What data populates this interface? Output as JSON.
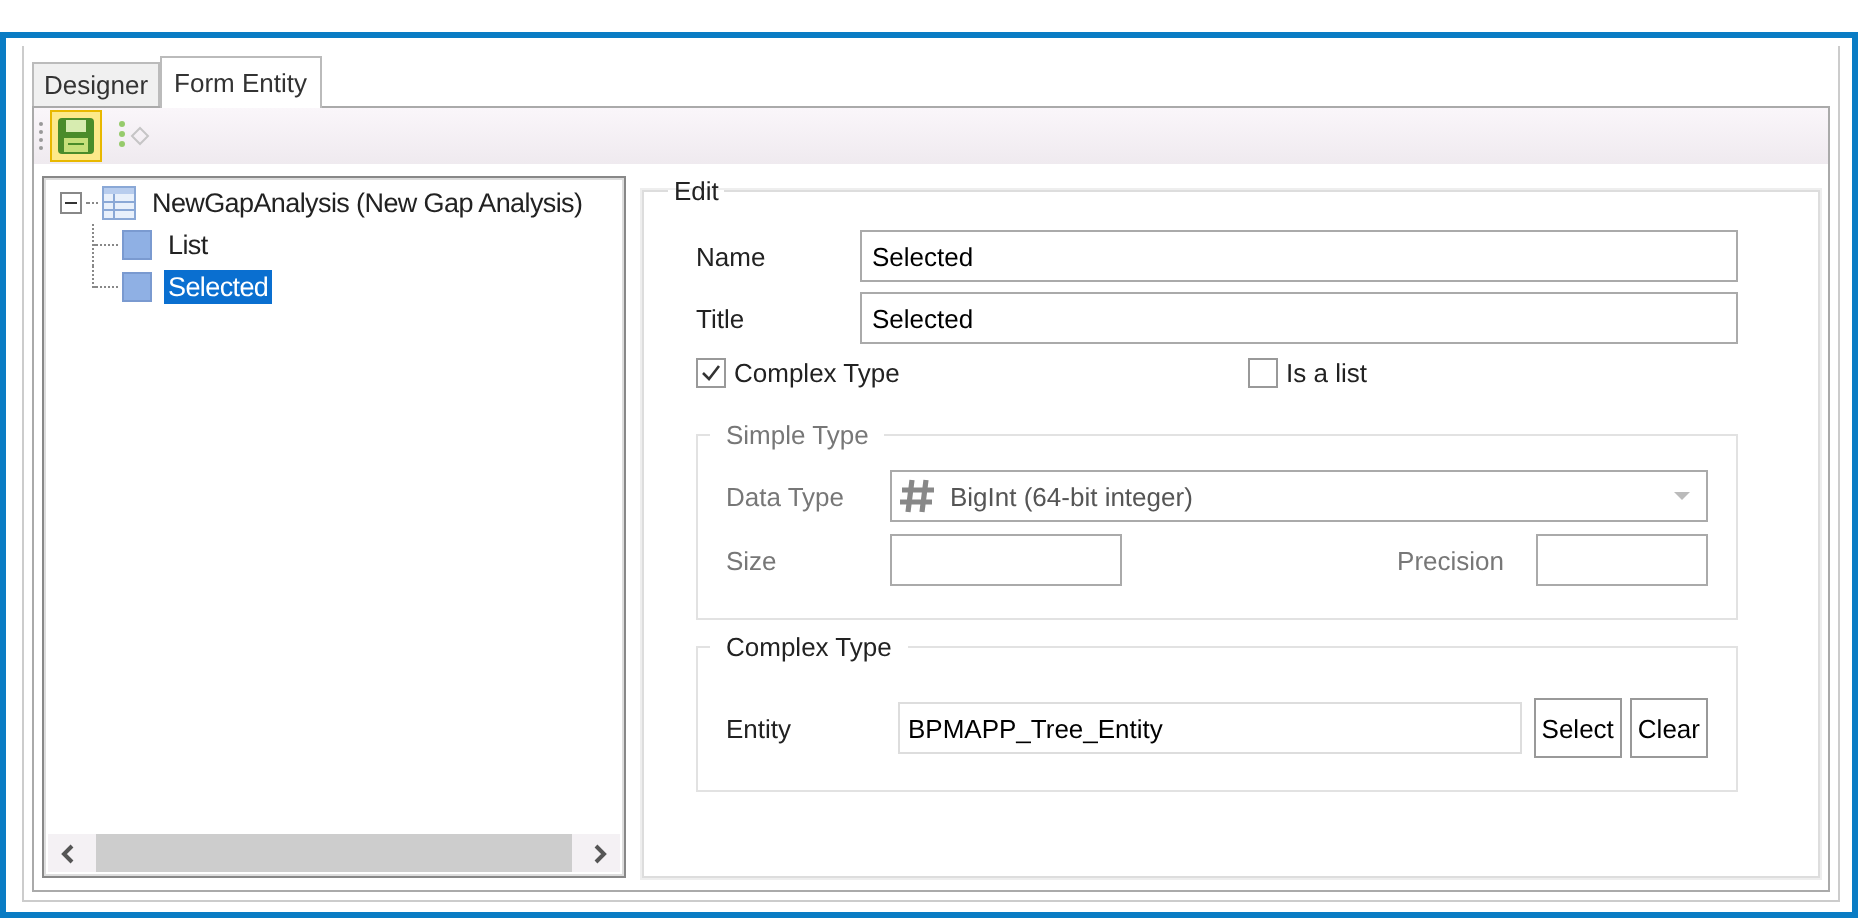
{
  "tabs": [
    {
      "label": "Designer",
      "selected": false
    },
    {
      "label": "Form Entity",
      "selected": true
    }
  ],
  "toolbar": [
    {
      "kind": "save",
      "disabled": false,
      "highlighted": true
    },
    {
      "kind": "tree-add",
      "disabled": true,
      "highlighted": false
    }
  ],
  "tree": [
    {
      "label": "NewGapAnalysis (New Gap Analysis)",
      "kind": "entity",
      "expanded": true,
      "selected": false,
      "children": [
        {
          "label": "List",
          "kind": "field",
          "selected": false
        },
        {
          "label": "Selected",
          "kind": "field",
          "selected": true
        }
      ]
    }
  ],
  "edit": {
    "title": "Edit",
    "name": {
      "label": "Name",
      "value": "Selected"
    },
    "title_field": {
      "label": "Title",
      "value": "Selected"
    },
    "complex_type_check": {
      "label": "Complex Type",
      "checked": true
    },
    "is_list_check": {
      "label": "Is a list",
      "checked": false
    },
    "simple_type": {
      "title": "Simple Type",
      "disabled": true,
      "data_type": {
        "label": "Data Type",
        "value": "BigInt (64-bit integer)"
      },
      "size": {
        "label": "Size"
      },
      "precision": {
        "label": "Precision"
      }
    },
    "complex_type": {
      "title": "Complex Type",
      "entity": {
        "label": "Entity",
        "value": "BPMAPP_Tree_Entity"
      },
      "buttons": [
        "Select",
        "Clear"
      ]
    }
  }
}
